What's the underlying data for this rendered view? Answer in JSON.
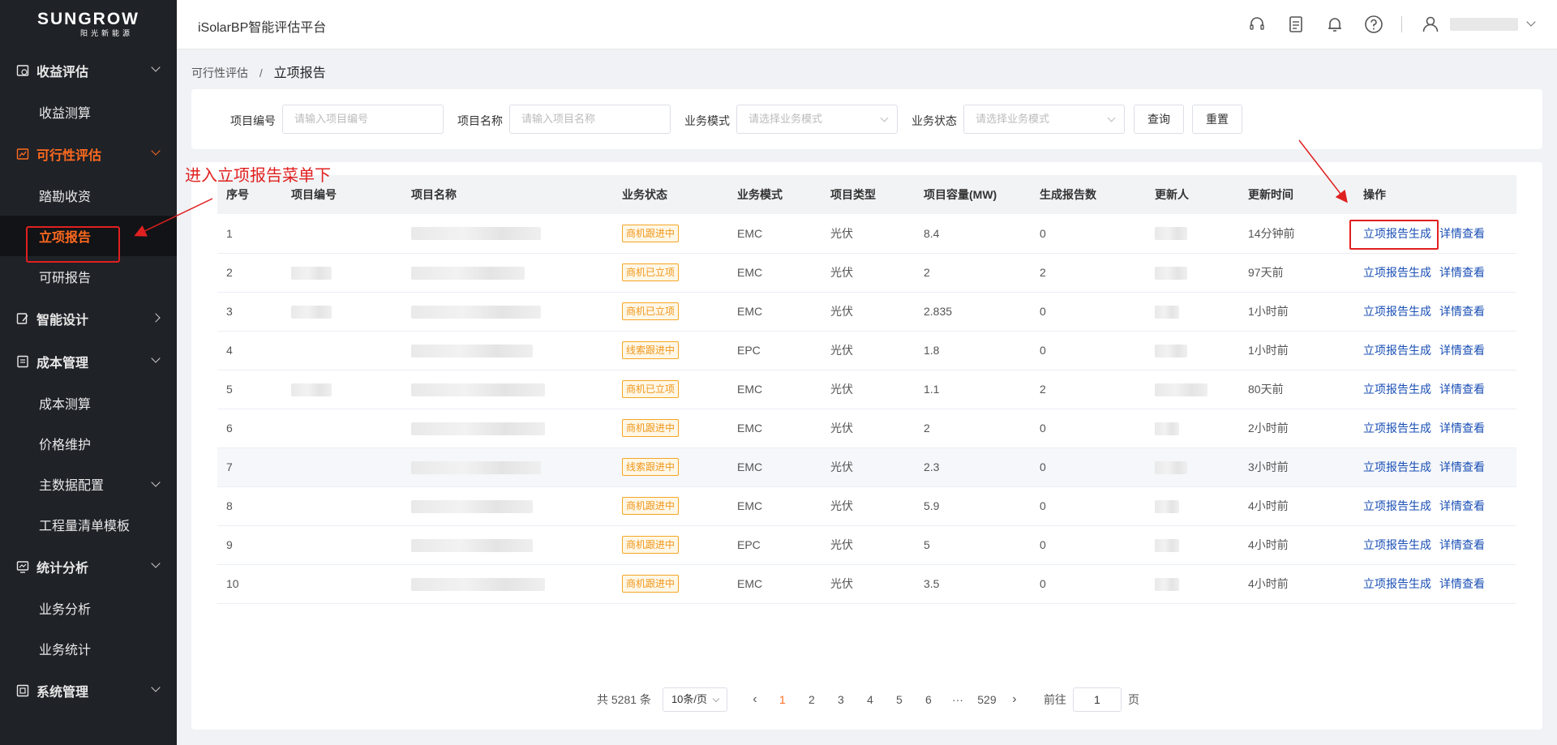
{
  "sidebar": {
    "brand": "SUNGROW",
    "brand_sub": "阳光新能源",
    "menu": [
      {
        "label": "收益评估",
        "icon": "profit-icon"
      },
      {
        "label": "收益测算"
      },
      {
        "label": "可行性评估",
        "icon": "chart-icon"
      },
      {
        "label": "踏勘收资"
      },
      {
        "label": "立项报告"
      },
      {
        "label": "可研报告"
      },
      {
        "label": "智能设计",
        "icon": "design-icon"
      },
      {
        "label": "成本管理",
        "icon": "cost-icon"
      },
      {
        "label": "成本测算"
      },
      {
        "label": "价格维护"
      },
      {
        "label": "主数据配置"
      },
      {
        "label": "工程量清单模板"
      },
      {
        "label": "统计分析",
        "icon": "analysis-icon"
      },
      {
        "label": "业务分析"
      },
      {
        "label": "业务统计"
      },
      {
        "label": "系统管理",
        "icon": "system-icon"
      }
    ]
  },
  "header": {
    "title": "iSolarBP智能评估平台",
    "icons": [
      "headset-icon",
      "document-icon",
      "bell-icon",
      "help-icon",
      "user-icon"
    ]
  },
  "breadcrumb": {
    "parent": "可行性评估",
    "sep": "/",
    "current": "立项报告"
  },
  "filters": {
    "code_label": "项目编号",
    "code_placeholder": "请输入项目编号",
    "name_label": "项目名称",
    "name_placeholder": "请输入项目名称",
    "mode_label": "业务模式",
    "mode_placeholder": "请选择业务模式",
    "status_label": "业务状态",
    "status_placeholder": "请选择业务模式",
    "query_btn": "查询",
    "reset_btn": "重置"
  },
  "table": {
    "headers": [
      "序号",
      "项目编号",
      "项目名称",
      "业务状态",
      "业务模式",
      "项目类型",
      "项目容量(MW)",
      "生成报告数",
      "更新人",
      "更新时间",
      "操作"
    ],
    "rows": [
      {
        "no": "1",
        "status": "商机跟进中",
        "mode": "EMC",
        "type": "光伏",
        "cap": "8.4",
        "reports": "0",
        "time": "14分钟前"
      },
      {
        "no": "2",
        "status": "商机已立项",
        "mode": "EMC",
        "type": "光伏",
        "cap": "2",
        "reports": "2",
        "time": "97天前"
      },
      {
        "no": "3",
        "status": "商机已立项",
        "mode": "EMC",
        "type": "光伏",
        "cap": "2.835",
        "reports": "0",
        "time": "1小时前"
      },
      {
        "no": "4",
        "status": "线索跟进中",
        "mode": "EPC",
        "type": "光伏",
        "cap": "1.8",
        "reports": "0",
        "time": "1小时前"
      },
      {
        "no": "5",
        "status": "商机已立项",
        "mode": "EMC",
        "type": "光伏",
        "cap": "1.1",
        "reports": "2",
        "time": "80天前"
      },
      {
        "no": "6",
        "status": "商机跟进中",
        "mode": "EMC",
        "type": "光伏",
        "cap": "2",
        "reports": "0",
        "time": "2小时前"
      },
      {
        "no": "7",
        "status": "线索跟进中",
        "mode": "EMC",
        "type": "光伏",
        "cap": "2.3",
        "reports": "0",
        "time": "3小时前"
      },
      {
        "no": "8",
        "status": "商机跟进中",
        "mode": "EMC",
        "type": "光伏",
        "cap": "5.9",
        "reports": "0",
        "time": "4小时前"
      },
      {
        "no": "9",
        "status": "商机跟进中",
        "mode": "EPC",
        "type": "光伏",
        "cap": "5",
        "reports": "0",
        "time": "4小时前"
      },
      {
        "no": "10",
        "status": "商机跟进中",
        "mode": "EMC",
        "type": "光伏",
        "cap": "3.5",
        "reports": "0",
        "time": "4小时前"
      }
    ],
    "op_generate": "立项报告生成",
    "op_detail": "详情查看"
  },
  "annotation": "进入立项报告菜单下",
  "pagination": {
    "total": "共 5281 条",
    "page_size": "10条/页",
    "pages": [
      "1",
      "2",
      "3",
      "4",
      "5",
      "6",
      "···",
      "529"
    ],
    "goto_prefix": "前往",
    "goto_value": "1",
    "goto_suffix": "页"
  }
}
